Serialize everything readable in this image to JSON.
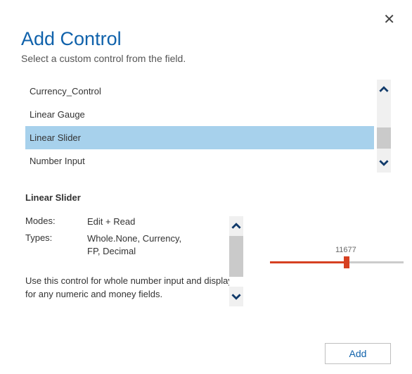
{
  "close_label": "✕",
  "title": "Add Control",
  "subtitle": "Select a custom control from the field.",
  "list": {
    "items": [
      {
        "label": "Currency_Control",
        "selected": false
      },
      {
        "label": "Linear Gauge",
        "selected": false
      },
      {
        "label": "Linear Slider",
        "selected": true
      },
      {
        "label": "Number Input",
        "selected": false
      }
    ]
  },
  "details": {
    "name": "Linear Slider",
    "modes_label": "Modes:",
    "modes_value": "Edit + Read",
    "types_label": "Types:",
    "types_value": "Whole.None, Currency, FP, Decimal",
    "description": "Use this control for whole number input and display for any numeric and money fields."
  },
  "preview": {
    "value": "11677"
  },
  "footer": {
    "add_label": "Add"
  }
}
